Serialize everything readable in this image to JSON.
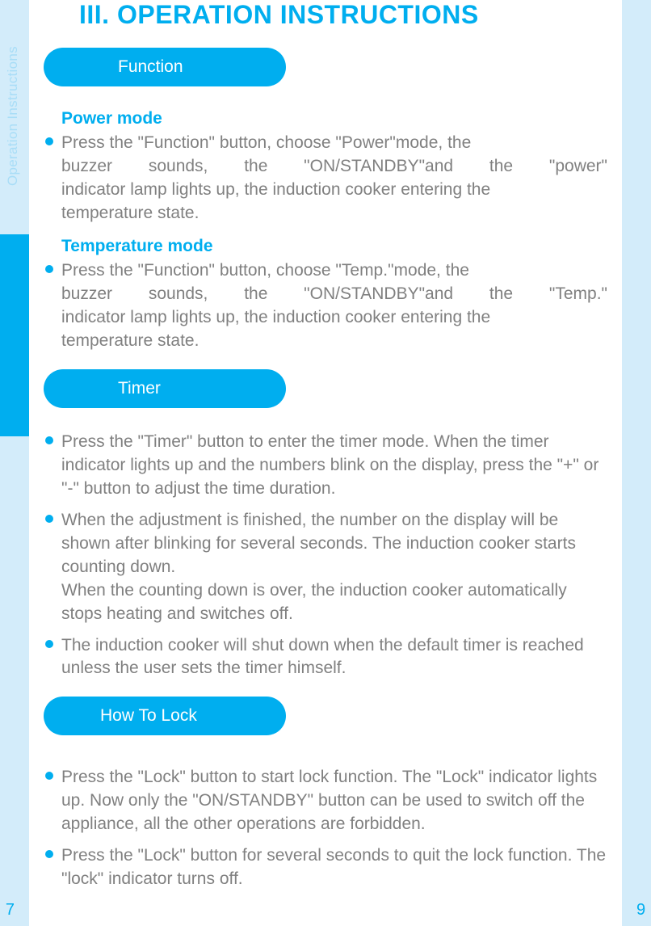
{
  "side_tab": "Operation Instructions",
  "page_left": "7",
  "page_right": "9",
  "heading": "III. OPERATION INSTRUCTIONS",
  "sections": {
    "function": {
      "pill": "Function",
      "power": {
        "title": "Power mode",
        "p1a": "Press the \"Function\" button, choose \"Power\"mode, the",
        "p1b": "buzzer sounds, the \"ON/STANDBY\"and the \"power\"",
        "p1c": "indicator lamp lights up, the induction cooker entering the",
        "p1d": "temperature state."
      },
      "temp": {
        "title": "Temperature mode",
        "p1a": "Press the \"Function\" button, choose \"Temp.\"mode, the",
        "p1b": "buzzer sounds, the \"ON/STANDBY\"and the \"Temp.\"",
        "p1c": "indicator lamp lights up, the induction cooker entering the",
        "p1d": "temperature state."
      }
    },
    "timer": {
      "pill": "Timer",
      "b1": "Press the \"Timer\" button to enter the timer mode. When the timer indicator lights up and the numbers blink on the display, press the \"+\" or \"-\" button to adjust the time duration.",
      "b2": "When the adjustment is finished, the number on the display will be shown after blinking for several seconds. The induction cooker starts counting down.\nWhen the counting down is over, the induction cooker automatically stops heating and switches off.",
      "b3": "The induction cooker will shut down when the default timer is reached unless the user sets the timer himself."
    },
    "lock": {
      "pill": "How To Lock",
      "b1": "Press the \"Lock\" button to start lock function. The \"Lock\" indicator lights up. Now only the \"ON/STANDBY\" button can be used to switch off the appliance, all the other operations are forbidden.",
      "b2": "Press the \"Lock\" button for several seconds to quit the lock function. The \"lock\" indicator turns off."
    }
  }
}
